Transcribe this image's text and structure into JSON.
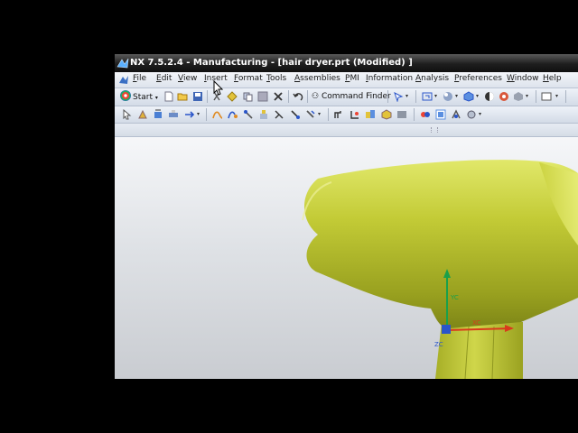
{
  "window": {
    "title": "NX 7.5.2.4 - Manufacturing - [hair dryer.prt (Modified) ]"
  },
  "menubar": {
    "items": [
      {
        "label": "File",
        "hotkey": "F",
        "rest": "ile"
      },
      {
        "label": "Edit",
        "hotkey": "E",
        "rest": "dit"
      },
      {
        "label": "View",
        "hotkey": "V",
        "rest": "iew"
      },
      {
        "label": "Insert",
        "hotkey": "I",
        "rest": "nsert"
      },
      {
        "label": "Format",
        "hotkey": "F",
        "rest": "ormat"
      },
      {
        "label": "Tools",
        "hotkey": "T",
        "rest": "ools"
      },
      {
        "label": "Assemblies",
        "hotkey": "A",
        "rest": "ssemblies"
      },
      {
        "label": "PMI",
        "hotkey": "P",
        "rest": "MI"
      },
      {
        "label": "Information",
        "hotkey": "I",
        "rest": "nformation"
      },
      {
        "label": "Analysis",
        "hotkey": "A",
        "rest": "nalysis"
      },
      {
        "label": "Preferences",
        "hotkey": "P",
        "rest": "references"
      },
      {
        "label": "Window",
        "hotkey": "W",
        "rest": "indow"
      },
      {
        "label": "Help",
        "hotkey": "H",
        "rest": "elp"
      }
    ]
  },
  "toolbar": {
    "start_label": "Start",
    "command_finder_label": "Command Finder",
    "icons": [
      "new-icon",
      "open-icon",
      "save-icon",
      "cut-icon",
      "copy-icon",
      "paste-icon",
      "delete-icon",
      "undo-icon",
      "repeat-icon",
      "snap-icon",
      "fit-icon",
      "render-style-icon",
      "shading-icon",
      "orient-icon",
      "display-icon",
      "layer-icon",
      "box-icon"
    ]
  },
  "viewport": {
    "model": "hair dryer",
    "model_color": "#b9c232",
    "csys": {
      "x_label": "XC",
      "y_label": "YC",
      "z_label": "ZC"
    }
  },
  "colors": {
    "title_bar": "#1e1e1e",
    "menu_bar": "#e6ebf2",
    "axis_x": "#d93a1c",
    "axis_y": "#1aa04a",
    "axis_z": "#2a55c9"
  }
}
